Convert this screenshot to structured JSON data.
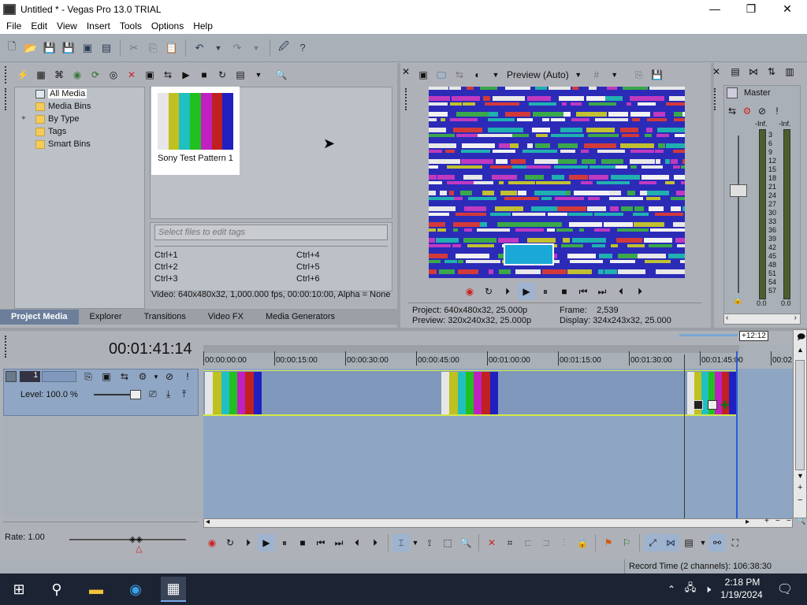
{
  "window": {
    "title": "Untitled * - Vegas Pro 13.0 TRIAL",
    "minimize": "—",
    "maximize": "❐",
    "close": "✕"
  },
  "menu": [
    "File",
    "Edit",
    "View",
    "Insert",
    "Tools",
    "Options",
    "Help"
  ],
  "media_tree": {
    "items": [
      "All Media",
      "Media Bins",
      "By Type",
      "Tags",
      "Smart Bins"
    ],
    "expander": "+"
  },
  "media": {
    "thumbnail_label": "Sony Test Pattern 1",
    "tags_placeholder": "Select files to edit tags",
    "shortcuts": [
      "Ctrl+1",
      "Ctrl+2",
      "Ctrl+3",
      "Ctrl+4",
      "Ctrl+5",
      "Ctrl+6"
    ],
    "info": "Video: 640x480x32, 1,000.000 fps, 00:00:10:00, Alpha = None",
    "test_pattern_colors": [
      "#e6e6e6",
      "#c0c020",
      "#20c0c0",
      "#20c020",
      "#c020c0",
      "#c02020",
      "#2020c0"
    ]
  },
  "tabs": [
    "Project Media",
    "Explorer",
    "Transitions",
    "Video FX",
    "Media Generators"
  ],
  "preview": {
    "quality": "Preview (Auto)",
    "project_label": "Project:",
    "project_value": "640x480x32, 25.000p",
    "preview_label": "Preview:",
    "preview_value": "320x240x32, 25.000p",
    "frame_label": "Frame:",
    "frame_value": "2,539",
    "display_label": "Display:",
    "display_value": "324x243x32, 25.000"
  },
  "mixer": {
    "title": "Master",
    "peak_left": "-Inf.",
    "peak_right": "-Inf.",
    "scale": [
      "3",
      "6",
      "9",
      "12",
      "15",
      "18",
      "21",
      "24",
      "27",
      "30",
      "33",
      "36",
      "39",
      "42",
      "45",
      "48",
      "51",
      "54",
      "57"
    ],
    "readout_left": "0.0",
    "readout_right": "0.0"
  },
  "timeline": {
    "time": "00:01:41:14",
    "offset": "+12:12",
    "ruler": [
      "00:00:00:00",
      "00:00:15:00",
      "00:00:30:00",
      "00:00:45:00",
      "00:01:00:00",
      "00:01:15:00",
      "00:01:30:00",
      "00:01:45:00",
      "00:02"
    ],
    "track_number": "1",
    "level": "Level: 100.0 %",
    "rate": "Rate: 1.00"
  },
  "status": {
    "record_time": "Record Time (2 channels): 106:38:30"
  },
  "taskbar": {
    "time": "2:18 PM",
    "date": "1/19/2024"
  }
}
